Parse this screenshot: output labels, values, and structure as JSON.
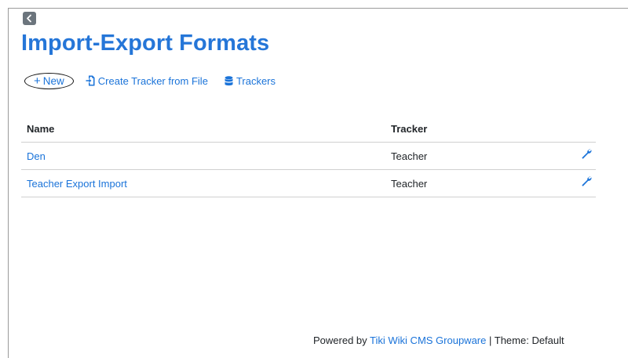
{
  "header": {
    "back_icon": "chevron-left-icon",
    "title": "Import-Export Formats"
  },
  "actions": {
    "new_label": "New",
    "create_label": "Create Tracker from File",
    "trackers_label": "Trackers",
    "icons": [
      "plus-icon",
      "file-import-icon",
      "database-icon"
    ]
  },
  "table": {
    "headers": {
      "name": "Name",
      "tracker": "Tracker"
    },
    "rows": [
      {
        "name": "Den",
        "tracker": "Teacher",
        "action_icon": "wrench-icon"
      },
      {
        "name": "Teacher Export Import",
        "tracker": "Teacher",
        "action_icon": "wrench-icon"
      }
    ]
  },
  "footer": {
    "prefix": "Powered by",
    "link": "Tiki Wiki CMS Groupware",
    "theme": " | Theme: Default"
  },
  "colors": {
    "accent": "#2576d8",
    "link": "#1a73d9",
    "back_button": "#6c757d"
  }
}
